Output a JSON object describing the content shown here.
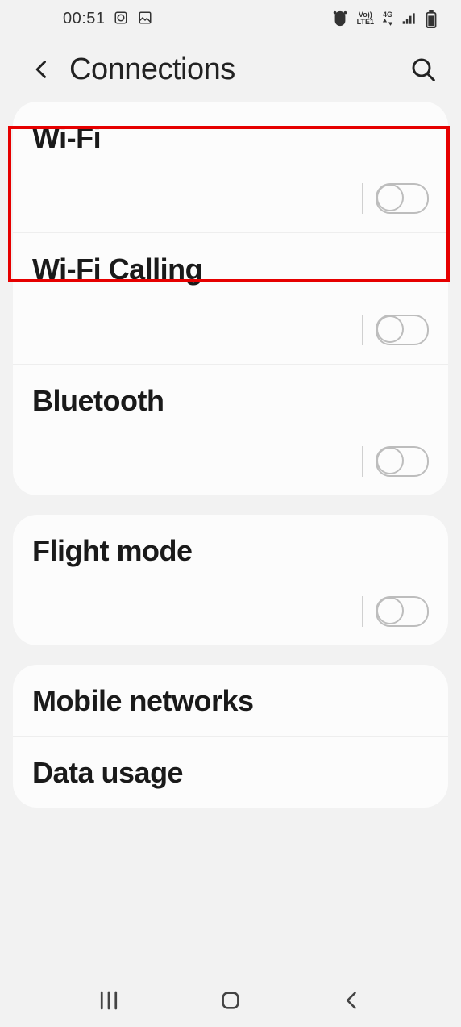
{
  "status_bar": {
    "clock": "00:51",
    "net_top": "Vo))",
    "net_bot": "LTE1",
    "gen": "4G"
  },
  "header": {
    "title": "Connections"
  },
  "groups": [
    {
      "items": [
        {
          "label": "Wi-Fi",
          "toggle": true,
          "highlight": true
        },
        {
          "label": "Wi-Fi Calling",
          "toggle": true
        },
        {
          "label": "Bluetooth",
          "toggle": true
        }
      ]
    },
    {
      "items": [
        {
          "label": "Flight mode",
          "toggle": true
        }
      ]
    },
    {
      "items": [
        {
          "label": "Mobile networks",
          "toggle": false
        },
        {
          "label": "Data usage",
          "toggle": false
        }
      ]
    }
  ]
}
